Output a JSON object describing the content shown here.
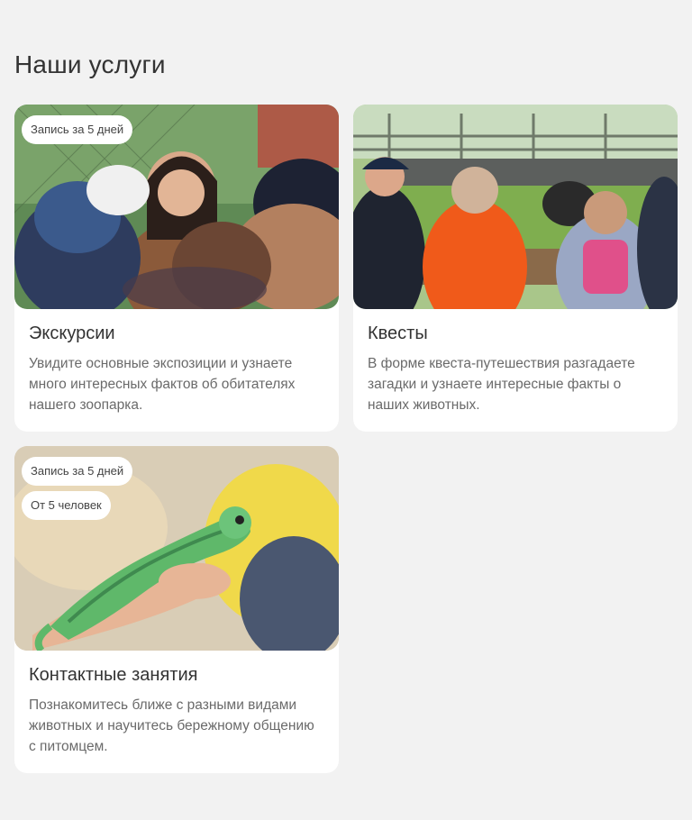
{
  "section": {
    "title": "Наши услуги"
  },
  "services": [
    {
      "title": "Экскурсии",
      "description": "Увидите основные экспозиции и узнаете много интересных фактов об обитателях нашего зоопарка.",
      "badges": [
        "Запись за 5 дней"
      ],
      "image": "photo-excursion-children-with-guide"
    },
    {
      "title": "Квесты",
      "description": "В форме квеста-путешествия разгадаете загадки и узнаете интересные факты о наших животных.",
      "badges": [],
      "image": "photo-quest-children-at-enclosure"
    },
    {
      "title": "Контактные занятия",
      "description": "Познакомитесь ближе с разными видами животных и научитесь бережному общению с питомцем.",
      "badges": [
        "Запись за 5 дней",
        "От 5 человек"
      ],
      "image": "photo-chameleon-on-hand"
    }
  ],
  "colors": {
    "background": "#f2f2f2",
    "card": "#ffffff",
    "text": "#333333",
    "muted": "#6a6a6a"
  }
}
